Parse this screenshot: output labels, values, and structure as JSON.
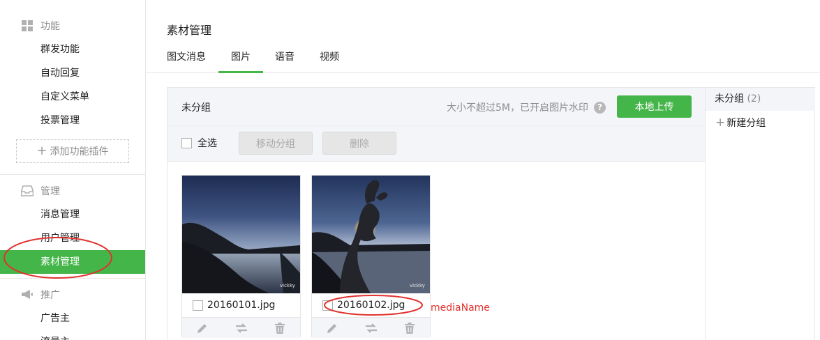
{
  "sidebar": {
    "sections": [
      {
        "title": "功能",
        "icon": "grid-icon",
        "items": [
          "群发功能",
          "自动回复",
          "自定义菜单",
          "投票管理"
        ]
      },
      {
        "title": "管理",
        "icon": "inbox-icon",
        "items": [
          "消息管理",
          "用户管理",
          "素材管理"
        ]
      },
      {
        "title": "推广",
        "icon": "megaphone-icon",
        "items": [
          "广告主",
          "流量主"
        ]
      }
    ],
    "add_plugin_label": "添加功能插件",
    "active_item": "素材管理"
  },
  "main": {
    "title": "素材管理",
    "tabs": [
      "图文消息",
      "图片",
      "语音",
      "视频"
    ],
    "active_tab": "图片",
    "panel": {
      "group_name": "未分组",
      "upload_hint": "大小不超过5M，已开启图片水印",
      "upload_button": "本地上传",
      "select_all": "全选",
      "move_group_button": "移动分组",
      "delete_button": "删除"
    },
    "images": [
      {
        "name": "20160101.jpg",
        "watermark": "vickky"
      },
      {
        "name": "20160102.jpg",
        "watermark": "vickky"
      }
    ]
  },
  "groups": {
    "items": [
      {
        "label": "未分组",
        "count": "(2)"
      }
    ],
    "new_group": "新建分组"
  },
  "annotation": {
    "label": "mediaName",
    "color": "#e0322f"
  },
  "colors": {
    "accent": "#44b549",
    "panel_bg": "#f4f5f9",
    "muted": "#8d8d8d"
  }
}
